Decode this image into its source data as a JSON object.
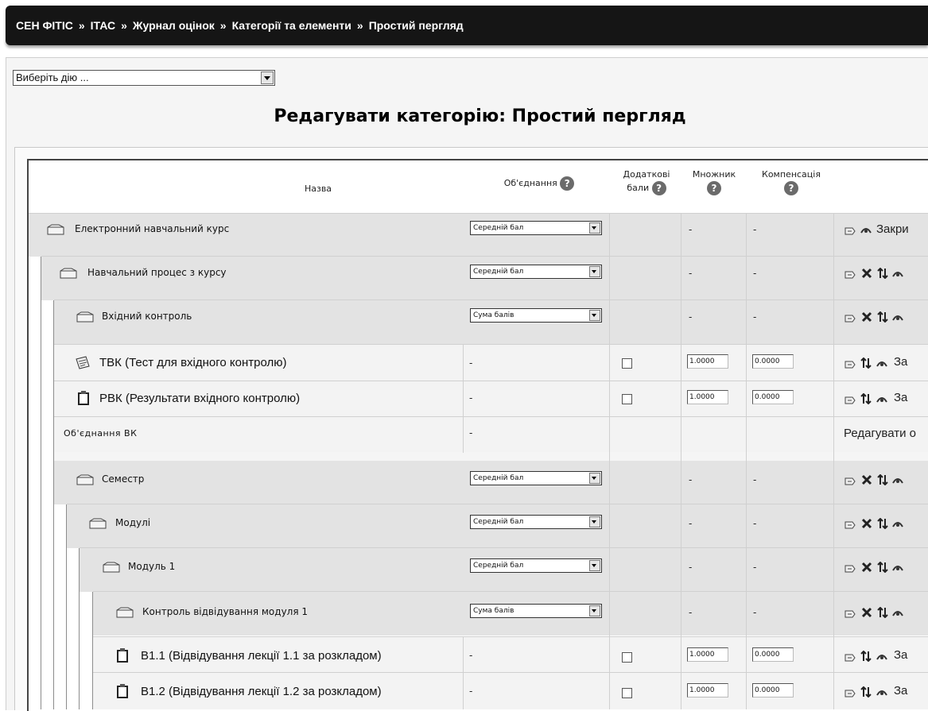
{
  "breadcrumb": [
    "СЕН ФІТІС",
    "ІТАС",
    "Журнал оцінок",
    "Категорії та елементи",
    "Простий пергляд"
  ],
  "breadcrumb_separator": "»",
  "action_select": {
    "value": "Виберіть дію ..."
  },
  "page_title": "Редагувати категорію: Простий пергляд",
  "columns": {
    "name": "Назва",
    "aggregation": "Об'єднання",
    "extra_credit_line1": "Додаткові",
    "extra_credit_line2": "бали",
    "multiplier": "Множник",
    "offset": "Компенсація",
    "help_glyph": "?"
  },
  "rows": [
    {
      "name": "Електронний навчальний курс",
      "aggregation": "Середній бал",
      "multiplier": "-",
      "offset": "-",
      "action_text": "Закри"
    },
    {
      "name": "Навчальний процес з курсу",
      "aggregation": "Середній бал",
      "multiplier": "-",
      "offset": "-"
    },
    {
      "name": "Вхідний контроль",
      "aggregation": "Сума балів",
      "multiplier": "-",
      "offset": "-"
    },
    {
      "name": "ТВК (Тест для вхідного контролю)",
      "aggregation": "-",
      "multiplier": "1.0000",
      "offset": "0.0000",
      "action_text": "За"
    },
    {
      "name": "РВК (Результати вхідного контролю)",
      "aggregation": "-",
      "multiplier": "1.0000",
      "offset": "0.0000",
      "action_text": "За"
    },
    {
      "name": "Об'єднання  ВК",
      "aggregation": "-",
      "action_text": "Редагувати о"
    },
    {
      "name": "Семестр",
      "aggregation": "Середній бал",
      "multiplier": "-",
      "offset": "-"
    },
    {
      "name": "Модулі",
      "aggregation": "Середній бал",
      "multiplier": "-",
      "offset": "-"
    },
    {
      "name": "Модуль 1",
      "aggregation": "Середній бал",
      "multiplier": "-",
      "offset": "-"
    },
    {
      "name": "Контроль відвідування модуля 1",
      "aggregation": "Сума балів",
      "multiplier": "-",
      "offset": "-"
    },
    {
      "name": "В1.1 (Відвідування лекції 1.1 за розкладом)",
      "aggregation": "-",
      "multiplier": "1.0000",
      "offset": "0.0000",
      "action_text": "За"
    },
    {
      "name": "В1.2 (Відвідування лекції 1.2 за розкладом)",
      "aggregation": "-",
      "multiplier": "1.0000",
      "offset": "0.0000",
      "action_text": "За"
    }
  ],
  "icons": [
    "folder-icon",
    "quiz-icon",
    "clipboard-icon",
    "edit-icon",
    "delete-icon",
    "move-icon",
    "hide-icon",
    "help-icon"
  ],
  "colors": {
    "navbar": "#151515",
    "category_row": "#e3e3e3",
    "item_row": "#f3f3f3"
  }
}
